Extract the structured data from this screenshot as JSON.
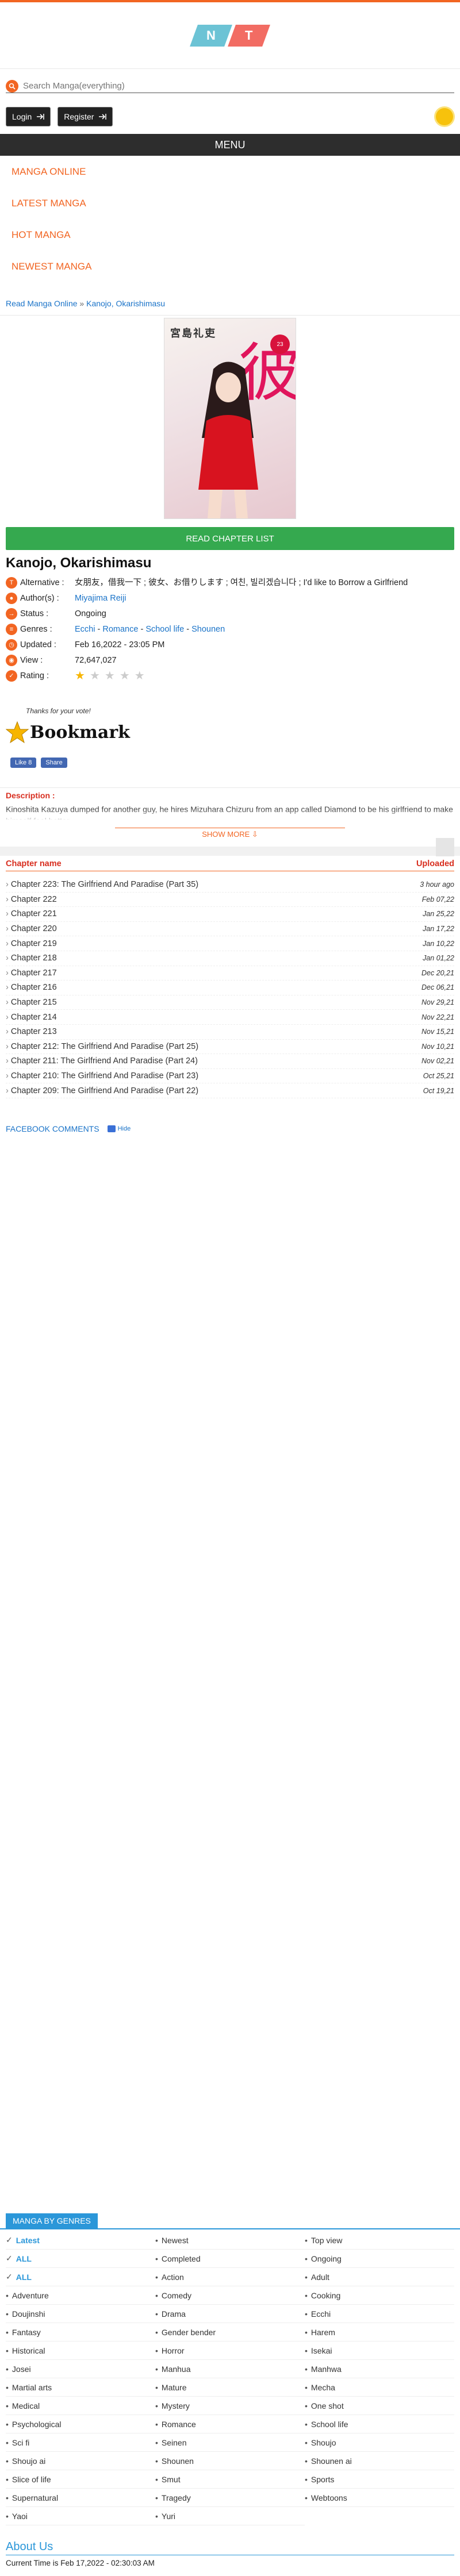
{
  "brand": {
    "logo_letters": [
      "N",
      "T"
    ],
    "colors": {
      "accent": "#f26522",
      "logo_left": "#6cc3d5",
      "logo_right": "#f26c63",
      "green": "#35a94f",
      "blue": "#2b97d9",
      "red": "#d82e1f"
    }
  },
  "search": {
    "placeholder": "Search Manga(everything)"
  },
  "auth": {
    "login_label": "Login",
    "register_label": "Register"
  },
  "menu": {
    "label": "MENU",
    "items": [
      "MANGA ONLINE",
      "LATEST MANGA",
      "HOT MANGA",
      "NEWEST MANGA"
    ]
  },
  "breadcrumb": {
    "home": "Read Manga Online",
    "separator": " » ",
    "current": "Kanojo, Okarishimasu"
  },
  "manga": {
    "cover_author": "宮島礼吏",
    "cover_kanji": "彼",
    "cover_badge": "23",
    "read_button": "READ CHAPTER LIST",
    "title": "Kanojo, Okarishimasu",
    "alternative_label": "Alternative :",
    "alternative": "女朋友，借我一下 ; 彼女、お借りします ; 여친, 빌리겠습니다 ; I'd like to Borrow a Girlfriend",
    "author_label": "Author(s) :",
    "author": "Miyajima Reiji",
    "status_label": "Status :",
    "status": "Ongoing",
    "genres_label": "Genres :",
    "genres": [
      "Ecchi",
      "Romance",
      "School life",
      "Shounen"
    ],
    "genre_sep": " - ",
    "updated_label": "Updated :",
    "updated": "Feb 16,2022 - 23:05 PM",
    "view_label": "View :",
    "view": "72,647,027",
    "rating_label": "Rating :",
    "rating": 1,
    "rating_max": 5,
    "thanks": "Thanks for your vote!",
    "bookmark_label": "Bookmark",
    "fb_like": "Like 8",
    "fb_share": "Share"
  },
  "description": {
    "label": "Description :",
    "text": "Kinoshita Kazuya dumped for another guy, he hires Mizuhara Chizuru from an app called Diamond to be his girlfriend to make himself feel better.",
    "show_more": "SHOW MORE ⇩"
  },
  "chapters": {
    "col_name": "Chapter name",
    "col_uploaded": "Uploaded",
    "rows": [
      {
        "name": "Chapter 223: The Girlfriend And Paradise (Part 35)",
        "date": "3 hour ago"
      },
      {
        "name": "Chapter 222",
        "date": "Feb 07,22"
      },
      {
        "name": "Chapter 221",
        "date": "Jan 25,22"
      },
      {
        "name": "Chapter 220",
        "date": "Jan 17,22"
      },
      {
        "name": "Chapter 219",
        "date": "Jan 10,22"
      },
      {
        "name": "Chapter 218",
        "date": "Jan 01,22"
      },
      {
        "name": "Chapter 217",
        "date": "Dec 20,21"
      },
      {
        "name": "Chapter 216",
        "date": "Dec 06,21"
      },
      {
        "name": "Chapter 215",
        "date": "Nov 29,21"
      },
      {
        "name": "Chapter 214",
        "date": "Nov 22,21"
      },
      {
        "name": "Chapter 213",
        "date": "Nov 15,21"
      },
      {
        "name": "Chapter 212: The Girlfriend And Paradise (Part 25)",
        "date": "Nov 10,21"
      },
      {
        "name": "Chapter 211: The Girlfriend And Paradise (Part 24)",
        "date": "Nov 02,21"
      },
      {
        "name": "Chapter 210: The Girlfriend And Paradise (Part 23)",
        "date": "Oct 25,21"
      },
      {
        "name": "Chapter 209: The Girlfriend And Paradise (Part 22)",
        "date": "Oct 19,21"
      }
    ]
  },
  "comments": {
    "label": "FACEBOOK COMMENTS",
    "hide": "Hide"
  },
  "genres_section": {
    "title": "MANGA BY GENRES",
    "items": [
      "Latest",
      "Newest",
      "Top view",
      "ALL",
      "Completed",
      "Ongoing",
      "ALL",
      "Action",
      "Adult",
      "Adventure",
      "Comedy",
      "Cooking",
      "Doujinshi",
      "Drama",
      "Ecchi",
      "Fantasy",
      "Gender bender",
      "Harem",
      "Historical",
      "Horror",
      "Isekai",
      "Josei",
      "Manhua",
      "Manhwa",
      "Martial arts",
      "Mature",
      "Mecha",
      "Medical",
      "Mystery",
      "One shot",
      "Psychological",
      "Romance",
      "School life",
      "Sci fi",
      "Seinen",
      "Shoujo",
      "Shoujo ai",
      "Shounen",
      "Shounen ai",
      "Slice of life",
      "Smut",
      "Sports",
      "Supernatural",
      "Tragedy",
      "Webtoons",
      "Yaoi",
      "Yuri"
    ],
    "active": [
      0,
      3,
      6
    ]
  },
  "footer": {
    "about": "About Us",
    "current_time": "Current Time is Feb 17,2022 - 02:30:03 AM"
  }
}
